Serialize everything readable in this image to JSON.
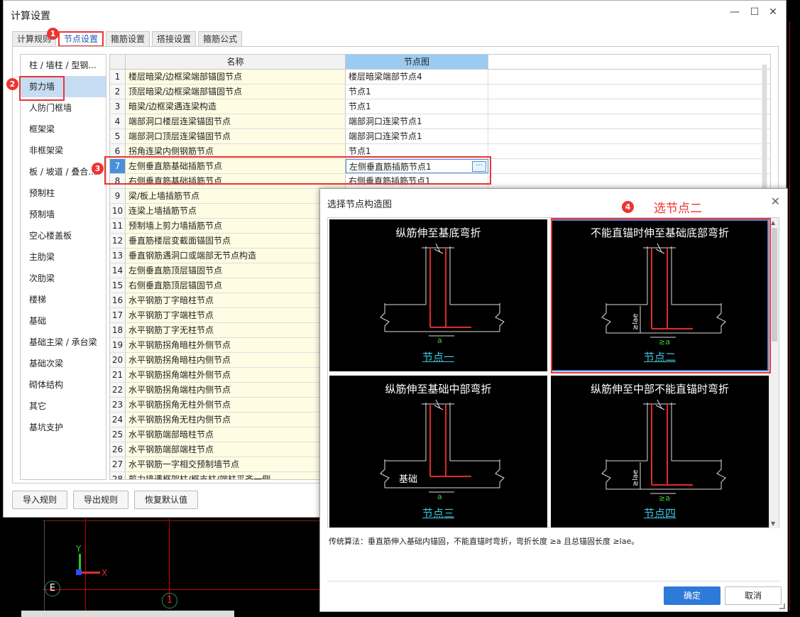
{
  "window": {
    "title": "计算设置",
    "minimize": "—",
    "maximize": "☐",
    "close": "✕"
  },
  "tabs": [
    {
      "label": "计算规则"
    },
    {
      "label": "节点设置"
    },
    {
      "label": "箍筋设置"
    },
    {
      "label": "搭接设置"
    },
    {
      "label": "箍筋公式"
    }
  ],
  "sidebar": {
    "items": [
      {
        "label": "柱 / 墙柱 / 型钢..."
      },
      {
        "label": "剪力墙"
      },
      {
        "label": "人防门框墙"
      },
      {
        "label": "框架梁"
      },
      {
        "label": "非框架梁"
      },
      {
        "label": "板 / 坡道 / 叠合..."
      },
      {
        "label": "预制柱"
      },
      {
        "label": "预制墙"
      },
      {
        "label": "空心楼盖板"
      },
      {
        "label": "主肋梁"
      },
      {
        "label": "次肋梁"
      },
      {
        "label": "楼梯"
      },
      {
        "label": "基础"
      },
      {
        "label": "基础主梁 / 承台梁"
      },
      {
        "label": "基础次梁"
      },
      {
        "label": "砌体结构"
      },
      {
        "label": "其它"
      },
      {
        "label": "基坑支护"
      }
    ]
  },
  "grid": {
    "col_name": "名称",
    "col_node": "节点图",
    "ellipsis": "···",
    "rows": [
      {
        "num": "1",
        "name": "楼层暗梁/边框梁端部锚固节点",
        "node": "楼层暗梁端部节点4"
      },
      {
        "num": "2",
        "name": "顶层暗梁/边框梁端部锚固节点",
        "node": "节点1"
      },
      {
        "num": "3",
        "name": "暗梁/边框梁遇连梁构造",
        "node": "节点1"
      },
      {
        "num": "4",
        "name": "端部洞口楼层连梁锚固节点",
        "node": "端部洞口连梁节点1"
      },
      {
        "num": "5",
        "name": "端部洞口顶层连梁锚固节点",
        "node": "端部洞口连梁节点1"
      },
      {
        "num": "6",
        "name": "拐角连梁内侧钢筋节点",
        "node": "节点1"
      },
      {
        "num": "7",
        "name": "左侧垂直筋基础插筋节点",
        "node": "左侧垂直筋插筋节点1"
      },
      {
        "num": "8",
        "name": "右侧垂直筋基础插筋节点",
        "node": "右侧垂直筋插筋节点1"
      },
      {
        "num": "9",
        "name": "梁/板上墙插筋节点",
        "node": ""
      },
      {
        "num": "10",
        "name": "连梁上墙插筋节点",
        "node": ""
      },
      {
        "num": "11",
        "name": "预制墙上剪力墙插筋节点",
        "node": ""
      },
      {
        "num": "12",
        "name": "垂直筋楼层变截面锚固节点",
        "node": ""
      },
      {
        "num": "13",
        "name": "垂直钢筋遇洞口或端部无节点构造",
        "node": ""
      },
      {
        "num": "14",
        "name": "左侧垂直筋顶层锚固节点",
        "node": ""
      },
      {
        "num": "15",
        "name": "右侧垂直筋顶层锚固节点",
        "node": ""
      },
      {
        "num": "16",
        "name": "水平钢筋丁字暗柱节点",
        "node": ""
      },
      {
        "num": "17",
        "name": "水平钢筋丁字端柱节点",
        "node": ""
      },
      {
        "num": "18",
        "name": "水平钢筋丁字无柱节点",
        "node": ""
      },
      {
        "num": "19",
        "name": "水平钢筋拐角暗柱外侧节点",
        "node": ""
      },
      {
        "num": "20",
        "name": "水平钢筋拐角暗柱内侧节点",
        "node": ""
      },
      {
        "num": "21",
        "name": "水平钢筋拐角端柱外侧节点",
        "node": ""
      },
      {
        "num": "22",
        "name": "水平钢筋拐角端柱内侧节点",
        "node": ""
      },
      {
        "num": "23",
        "name": "水平钢筋拐角无柱外侧节点",
        "node": ""
      },
      {
        "num": "24",
        "name": "水平钢筋拐角无柱内侧节点",
        "node": ""
      },
      {
        "num": "25",
        "name": "水平钢筋端部暗柱节点",
        "node": ""
      },
      {
        "num": "26",
        "name": "水平钢筋端部端柱节点",
        "node": ""
      },
      {
        "num": "27",
        "name": "水平钢筋一字相交预制墙节点",
        "node": ""
      },
      {
        "num": "28",
        "name": "剪力墙遇框架柱/框支柱/端柱平齐一侧",
        "node": ""
      }
    ]
  },
  "buttons": {
    "import": "导入规则",
    "export": "导出规则",
    "restore": "恢复默认值"
  },
  "callouts": [
    "1",
    "2",
    "3",
    "4"
  ],
  "dialog": {
    "title": "选择节点构造图",
    "close": "✕",
    "annotation": "选节点二",
    "cells": [
      {
        "caption": "纵筋伸至基底弯折",
        "label": "节点一",
        "extra": "",
        "dim": "a"
      },
      {
        "caption": "不能直锚时伸至基础底部弯折",
        "label": "节点二",
        "extra": "≥lae",
        "dim": "≥a"
      },
      {
        "caption": "纵筋伸至基础中部弯折",
        "label": "节点三",
        "extra": "基础",
        "dim": "a"
      },
      {
        "caption": "纵筋伸至中部不能直锚时弯折",
        "label": "节点四",
        "extra": "≥lae",
        "dim": "≥a"
      }
    ],
    "description": "传统算法：垂直筋伸入基础内锚固，不能直锚时弯折，弯折长度 ≥a 且总锚固长度 ≥lae。",
    "ok": "确定",
    "cancel": "取消"
  },
  "cad": {
    "axis_y": "Y",
    "axis_x": "X",
    "grid_e": "E",
    "grid_1": "1"
  }
}
